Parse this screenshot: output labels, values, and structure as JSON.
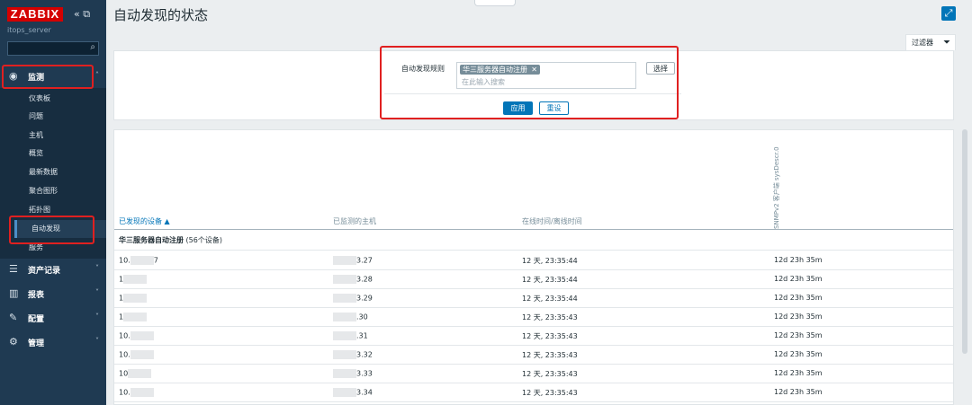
{
  "app": {
    "logo": "ZABBIX",
    "server": "itops_server",
    "collapse_icon": "double-chevron-left-icon",
    "undock_icon": "undock-icon"
  },
  "sidebar": {
    "search_placeholder": "",
    "sections": [
      {
        "label": "监测",
        "icon": "eye-icon",
        "chevron": "˄"
      },
      {
        "label": "资产记录",
        "icon": "list-icon",
        "chevron": "˅"
      },
      {
        "label": "报表",
        "icon": "bar-chart-icon",
        "chevron": "˅"
      },
      {
        "label": "配置",
        "icon": "wrench-icon",
        "chevron": "˅"
      },
      {
        "label": "管理",
        "icon": "gear-icon",
        "chevron": "˅"
      }
    ],
    "monitoring_items": [
      {
        "label": "仪表板"
      },
      {
        "label": "问题"
      },
      {
        "label": "主机"
      },
      {
        "label": "概览"
      },
      {
        "label": "最新数据"
      },
      {
        "label": "聚合图形"
      },
      {
        "label": "拓扑图"
      },
      {
        "label": "自动发现",
        "active": true
      },
      {
        "label": "服务"
      }
    ]
  },
  "page": {
    "title": "自动发现的状态"
  },
  "filter": {
    "tab_label": "过滤器",
    "rule_label": "自动发现规则",
    "selected_rule": "华三服务器自动注册",
    "search_placeholder": "在此输入搜索",
    "select_label": "选择",
    "apply_label": "应用",
    "reset_label": "重设"
  },
  "table": {
    "columns": [
      "已发现的设备 ▲",
      "已监测的主机",
      "在线时间/离线时间",
      "SNMPv2 客户端 sysDescr.0"
    ],
    "group": {
      "name": "华三服务器自动注册",
      "count": "(56个设备)"
    },
    "rows": [
      {
        "device": "10.",
        "device_tail": "7",
        "host": "3.27",
        "time": "12 天, 23:35:44",
        "sysdescr": "12d 23h 35m"
      },
      {
        "device": "1",
        "device_tail": "",
        "host": "3.28",
        "time": "12 天, 23:35:44",
        "sysdescr": "12d 23h 35m"
      },
      {
        "device": "1",
        "device_tail": "",
        "host": "3.29",
        "time": "12 天, 23:35:44",
        "sysdescr": "12d 23h 35m"
      },
      {
        "device": "1",
        "device_tail": "",
        "host": ".30",
        "time": "12 天, 23:35:43",
        "sysdescr": "12d 23h 35m"
      },
      {
        "device": "10.",
        "device_tail": "",
        "host": ".31",
        "time": "12 天, 23:35:43",
        "sysdescr": "12d 23h 35m"
      },
      {
        "device": "10.",
        "device_tail": "",
        "host": "3.32",
        "time": "12 天, 23:35:43",
        "sysdescr": "12d 23h 35m"
      },
      {
        "device": "10",
        "device_tail": "",
        "host": "3.33",
        "time": "12 天, 23:35:43",
        "sysdescr": "12d 23h 35m"
      },
      {
        "device": "10.",
        "device_tail": "",
        "host": "3.34",
        "time": "12 天, 23:35:43",
        "sysdescr": "12d 23h 35m"
      }
    ]
  },
  "colors": {
    "sidebar_bg": "#1f3a52",
    "logo_red": "#d40000",
    "primary_blue": "#0275b8",
    "annotation_red": "#e02020"
  }
}
